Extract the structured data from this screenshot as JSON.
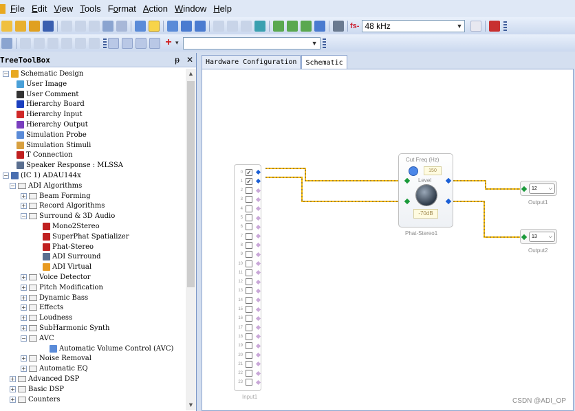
{
  "menu": {
    "items": [
      {
        "label": "File",
        "key": "F"
      },
      {
        "label": "Edit",
        "key": "E"
      },
      {
        "label": "View",
        "key": "V"
      },
      {
        "label": "Tools",
        "key": "T"
      },
      {
        "label": "Format",
        "key": "o"
      },
      {
        "label": "Action",
        "key": "A"
      },
      {
        "label": "Window",
        "key": "W"
      },
      {
        "label": "Help",
        "key": "H"
      }
    ]
  },
  "toolbar": {
    "fs_label": "fs-",
    "sample_rate": "48 kHz"
  },
  "toolbox": {
    "title": "TreeToolBox",
    "pin_glyph": "ᵽ",
    "close_glyph": "✕"
  },
  "tree": {
    "items": [
      {
        "label": "Schematic Design",
        "icon": "folder-icon",
        "color": "#e8a820"
      },
      {
        "label": "User Image",
        "icon": "image-icon",
        "color": "#4aa0d8"
      },
      {
        "label": "User Comment",
        "icon": "text-icon",
        "color": "#333333"
      },
      {
        "label": "Hierarchy Board",
        "icon": "hierarchy-board-icon",
        "color": "#1b3fbf"
      },
      {
        "label": "Hierarchy Input",
        "icon": "hierarchy-input-icon",
        "color": "#d02828"
      },
      {
        "label": "Hierarchy Output",
        "icon": "hierarchy-output-icon",
        "color": "#7a3fbf"
      },
      {
        "label": "Simulation Probe",
        "icon": "probe-icon",
        "color": "#5a8bd8"
      },
      {
        "label": "Simulation Stimuli",
        "icon": "stimuli-icon",
        "color": "#d8a040"
      },
      {
        "label": "T Connection",
        "icon": "t-connection-icon",
        "color": "#c02020"
      },
      {
        "label": "Speaker Response : MLSSA",
        "icon": "speaker-icon",
        "color": "#5a6f90"
      },
      {
        "label": "(IC 1) ADAU144x",
        "icon": "chip-icon",
        "color": "#4a6fb0"
      },
      {
        "label": "ADI Algorithms"
      },
      {
        "label": "Beam Forming"
      },
      {
        "label": "Record Algorithms"
      },
      {
        "label": "Surround & 3D Audio"
      },
      {
        "label": "Mono2Stereo",
        "icon": "mono2stereo-icon",
        "color": "#c02020"
      },
      {
        "label": "SuperPhat Spatializer",
        "icon": "spatializer-icon",
        "color": "#c02020"
      },
      {
        "label": "Phat-Stereo",
        "icon": "phat-stereo-icon",
        "color": "#c02020"
      },
      {
        "label": "ADI Surround",
        "icon": "surround-icon",
        "color": "#5a6f90"
      },
      {
        "label": "ADI Virtual",
        "icon": "virtual-icon",
        "color": "#e89a20"
      },
      {
        "label": "Voice Detector"
      },
      {
        "label": "Pitch Modification"
      },
      {
        "label": "Dynamic Bass"
      },
      {
        "label": "Effects"
      },
      {
        "label": "Loudness"
      },
      {
        "label": "SubHarmonic Synth"
      },
      {
        "label": "AVC"
      },
      {
        "label": "Automatic Volume Control (AVC)",
        "icon": "avc-icon",
        "color": "#5a8bd8"
      },
      {
        "label": "Noise Removal"
      },
      {
        "label": "Automatic EQ"
      },
      {
        "label": "Advanced DSP"
      },
      {
        "label": "Basic DSP"
      },
      {
        "label": "Counters"
      }
    ]
  },
  "tabs": [
    {
      "label": "Hardware Configuration"
    },
    {
      "label": "Schematic"
    }
  ],
  "schematic": {
    "input_block": {
      "label": "Input1",
      "channels": [
        "0",
        "1",
        "2",
        "3",
        "4",
        "5",
        "6",
        "7",
        "8",
        "9",
        "10",
        "11",
        "12",
        "13",
        "14",
        "15",
        "16",
        "17",
        "18",
        "19",
        "20",
        "21",
        "22",
        "23"
      ],
      "checked": [
        true,
        true,
        false,
        false,
        false,
        false,
        false,
        false,
        false,
        false,
        false,
        false,
        false,
        false,
        false,
        false,
        false,
        false,
        false,
        false,
        false,
        false,
        false,
        false
      ]
    },
    "phat_block": {
      "label": "Phat-Stereo1",
      "cut_freq_label": "Cut Freq (Hz)",
      "cut_freq_value": "150",
      "level_label": "Level",
      "level_value": "-70dB"
    },
    "outputs": [
      {
        "label": "Output1",
        "value": "12"
      },
      {
        "label": "Output2",
        "value": "13"
      }
    ],
    "wire_color": "#f5b800",
    "watermark": "CSDN @ADI_OP"
  }
}
